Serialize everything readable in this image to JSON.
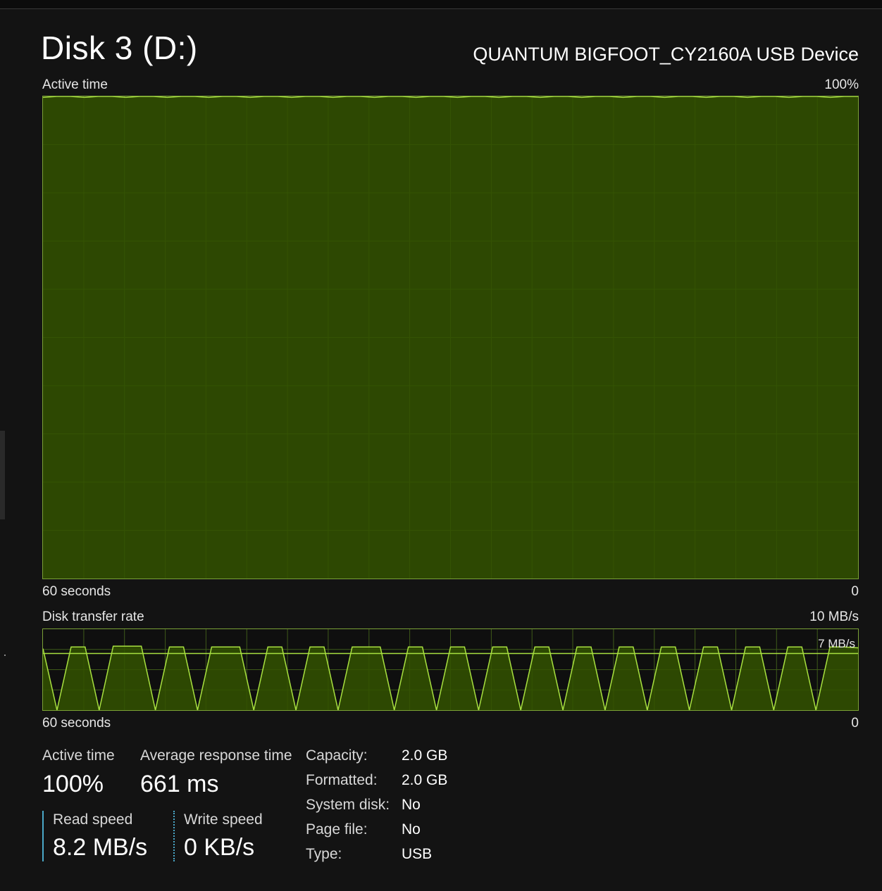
{
  "header": {
    "title": "Disk 3 (D:)",
    "device": "QUANTUM BIGFOOT_CY2160A USB Device"
  },
  "active_chart": {
    "label": "Active time",
    "max_label": "100%",
    "time_label": "60 seconds",
    "min_label": "0"
  },
  "transfer_chart": {
    "label": "Disk transfer rate",
    "max_label": "10 MB/s",
    "ref_label": "7 MB/s",
    "time_label": "60 seconds",
    "min_label": "0"
  },
  "stats": {
    "active_time_label": "Active time",
    "active_time_value": "100%",
    "avg_response_label": "Average response time",
    "avg_response_value": "661 ms",
    "read_label": "Read speed",
    "read_value": "8.2 MB/s",
    "write_label": "Write speed",
    "write_value": "0 KB/s"
  },
  "info": [
    {
      "label": "Capacity:",
      "value": "2.0 GB"
    },
    {
      "label": "Formatted:",
      "value": "2.0 GB"
    },
    {
      "label": "System disk:",
      "value": "No"
    },
    {
      "label": "Page file:",
      "value": "No"
    },
    {
      "label": "Type:",
      "value": "USB"
    }
  ],
  "colors": {
    "line": "#a8e040",
    "fill": "#335200",
    "grid": "#3f5a1a",
    "frame": "#7aa036",
    "read_accent": "#4aa8c8"
  },
  "chart_data": [
    {
      "type": "area",
      "title": "Active time",
      "xlabel": "60 seconds",
      "ylim": [
        0,
        100
      ],
      "unit": "%",
      "series": [
        {
          "values": [
            99.8,
            100,
            100,
            99.8,
            100,
            100,
            99.8,
            100,
            100,
            99.8,
            100,
            100,
            99.8,
            100,
            100,
            99.8,
            100,
            100,
            99.8,
            100,
            100,
            99.8,
            100,
            100,
            99.8,
            100,
            100,
            99.8,
            100,
            100,
            99.8,
            100,
            100,
            99.8,
            100,
            100,
            99.8,
            100,
            100,
            99.8,
            100,
            100,
            99.8,
            100,
            100,
            99.8,
            100,
            100,
            99.8,
            100,
            100,
            99.8,
            100,
            100,
            99.8,
            100,
            100,
            99.8,
            100,
            100
          ]
        }
      ]
    },
    {
      "type": "area",
      "title": "Disk transfer rate",
      "xlabel": "60 seconds",
      "ylim": [
        0,
        10
      ],
      "unit": "MB/s",
      "reference_line": 7,
      "series": [
        {
          "values": [
            7.6,
            0,
            7.8,
            7.8,
            0,
            7.9,
            7.9,
            7.9,
            0,
            7.8,
            7.8,
            0,
            7.8,
            7.8,
            7.8,
            0,
            7.8,
            7.8,
            0,
            7.8,
            7.8,
            0,
            7.8,
            7.8,
            7.8,
            0,
            7.8,
            7.8,
            0,
            7.8,
            7.8,
            0,
            7.8,
            7.8,
            0,
            7.8,
            7.8,
            0,
            7.8,
            7.8,
            0,
            7.8,
            7.8,
            0,
            7.8,
            7.8,
            0,
            7.8,
            7.8,
            0,
            7.8,
            7.8,
            0,
            7.8,
            7.8,
            0,
            7.8,
            7.8,
            7.7
          ]
        }
      ]
    }
  ]
}
